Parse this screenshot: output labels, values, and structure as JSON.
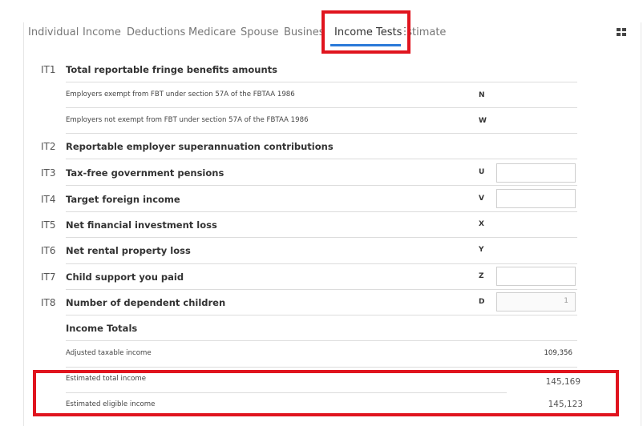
{
  "tabs": [
    {
      "label": "Individual"
    },
    {
      "label": "Income"
    },
    {
      "label": "Deductions"
    },
    {
      "label": "Medicare"
    },
    {
      "label": "Spouse"
    },
    {
      "label": "Business"
    },
    {
      "label": "Income Tests"
    },
    {
      "label": "Estimate"
    }
  ],
  "active_tab": "Income Tests",
  "items": {
    "it1": {
      "code": "IT1",
      "label": "Total reportable fringe benefits amounts"
    },
    "it1_sub1": {
      "label": "Employers exempt from FBT under section 57A of the FBTAA 1986",
      "letter": "N"
    },
    "it1_sub2": {
      "label": "Employers not exempt from FBT under section 57A of the FBTAA 1986",
      "letter": "W"
    },
    "it2": {
      "code": "IT2",
      "label": "Reportable employer superannuation contributions"
    },
    "it3": {
      "code": "IT3",
      "label": "Tax-free government pensions",
      "letter": "U",
      "value": ""
    },
    "it4": {
      "code": "IT4",
      "label": "Target foreign income",
      "letter": "V",
      "value": ""
    },
    "it5": {
      "code": "IT5",
      "label": "Net financial investment loss",
      "letter": "X"
    },
    "it6": {
      "code": "IT6",
      "label": "Net rental property loss",
      "letter": "Y"
    },
    "it7": {
      "code": "IT7",
      "label": "Child support you paid",
      "letter": "Z",
      "value": ""
    },
    "it8": {
      "code": "IT8",
      "label": "Number of dependent children",
      "letter": "D",
      "value": "1"
    }
  },
  "totals": {
    "heading": "Income Totals",
    "adjusted_taxable_label": "Adjusted taxable income",
    "adjusted_taxable_value": "109,356",
    "estimated_total_label": "Estimated total income",
    "estimated_total_value": "145,169",
    "estimated_eligible_label": "Estimated eligible income",
    "estimated_eligible_value": "145,123"
  },
  "colors": {
    "highlight": "#e0141e",
    "tab_underline": "#2a79d8"
  }
}
